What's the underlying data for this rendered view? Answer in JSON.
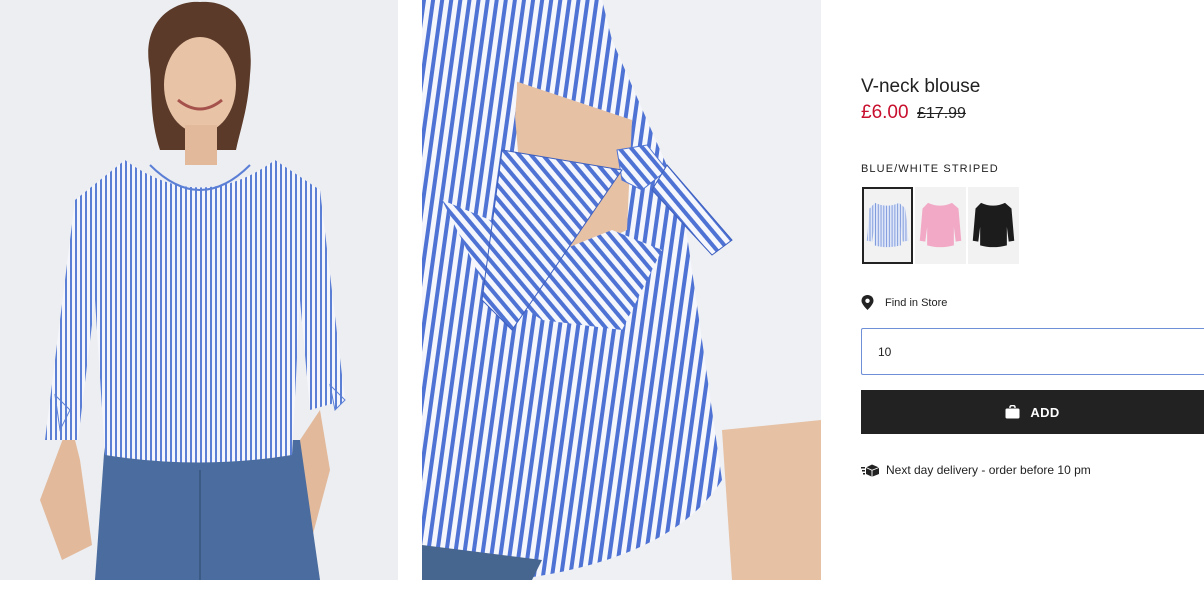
{
  "product": {
    "title": "V-neck blouse",
    "price_sale": "£6.00",
    "price_original": "£17.99",
    "color_name": "BLUE/WHITE STRIPED"
  },
  "swatches": [
    {
      "color": "#8aa6e0",
      "selected": true
    },
    {
      "color": "#f2a9c6",
      "selected": false
    },
    {
      "color": "#1c1c1c",
      "selected": false
    }
  ],
  "store": {
    "find_label": "Find in Store",
    "icon": "location-pin-icon"
  },
  "quantity": {
    "value": "10"
  },
  "cart": {
    "add_label": "ADD",
    "icon": "shopping-bag-icon"
  },
  "delivery": {
    "text": "Next day delivery - order before 10 pm",
    "icon": "delivery-truck-icon"
  },
  "colors": {
    "sale_red": "#c8102e",
    "button_black": "#222222",
    "input_border": "#6f8fd8",
    "stripe_blue": "#4f73d4"
  }
}
